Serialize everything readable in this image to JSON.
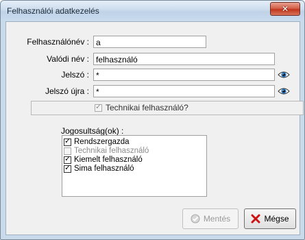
{
  "window": {
    "title": "Felhasználói adatkezelés"
  },
  "form": {
    "username_label": "Felhasználónév :",
    "username_value": "a",
    "realname_label": "Valódi név :",
    "realname_value": "felhasználó",
    "password_label": "Jelszó :",
    "password_value": "*",
    "password_repeat_label": "Jelszó újra :",
    "password_repeat_value": "*"
  },
  "technical_user": {
    "label": "Technikai felhasználó?",
    "checked": true,
    "enabled": false
  },
  "permissions": {
    "label": "Jogosultság(ok) :",
    "items": [
      {
        "label": "Rendszergazda",
        "checked": true,
        "enabled": true
      },
      {
        "label": "Technikai felhasználó",
        "checked": false,
        "enabled": false
      },
      {
        "label": "Kiemelt felhasználó",
        "checked": true,
        "enabled": true
      },
      {
        "label": "Sima felhasználó",
        "checked": true,
        "enabled": true
      }
    ]
  },
  "buttons": {
    "save_label": "Mentés",
    "cancel_label": "Mégse"
  },
  "icons": {
    "close": "close-icon",
    "eye": "eye-icon",
    "save": "check-circle-icon",
    "cancel": "red-x-icon"
  },
  "colors": {
    "cancel_x": "#cc1111",
    "eye_iris": "#1e6fb8"
  }
}
